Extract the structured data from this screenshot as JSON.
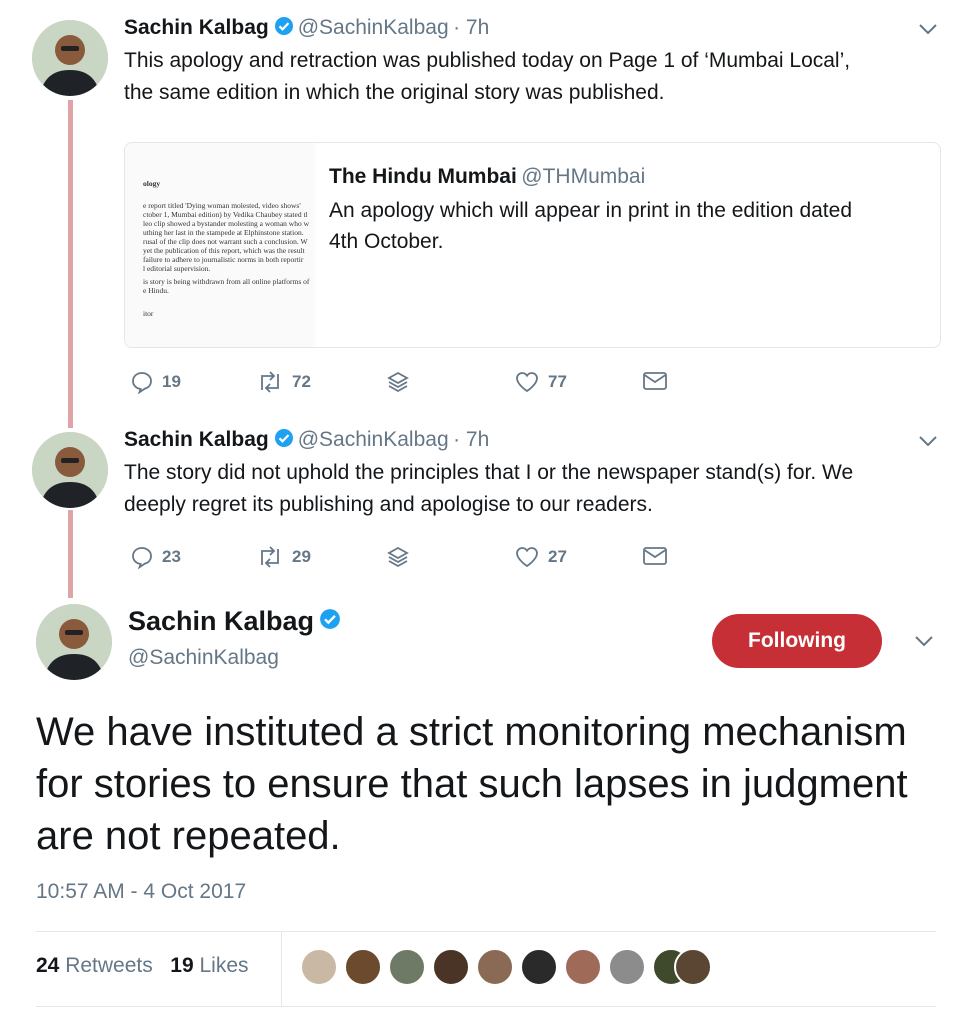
{
  "accent": "#c62f35",
  "verified_color": "#1da1f2",
  "tweets": [
    {
      "name": "Sachin Kalbag",
      "handle": "@SachinKalbag",
      "time": "· 7h",
      "text_line1": "This apology and retraction was published today on Page 1 of ‘Mumbai Local’,",
      "text_line2": "the same edition in which the original story was published.",
      "quote": {
        "name": "The Hindu Mumbai",
        "handle": "@THMumbai",
        "text_line1": "An apology which will appear in print in the edition dated",
        "text_line2": "4th October.",
        "doc_lines": [
          "ology",
          "e report titled 'Dying woman molested, video shows'",
          "ctober 1, Mumbai edition) by Vedika Chaubey stated tl",
          "leo clip showed a bystander molesting a woman who w",
          "uthing her last in the stampede at Elphinstone station.",
          "rusal of the clip does not warrant such a conclusion. W",
          "yet the publication of this report, which was the result",
          "failure to adhere to journalistic norms in both reportir",
          "l editorial supervision.",
          "is story is being withdrawn from all online platforms of",
          "e Hindu.",
          "itor"
        ]
      },
      "replies": "19",
      "retweets": "72",
      "likes": "77"
    },
    {
      "name": "Sachin Kalbag",
      "handle": "@SachinKalbag",
      "time": "· 7h",
      "text_line1": "The story did not uphold the principles that I or the newspaper stand(s) for. We",
      "text_line2": "deeply regret its publishing and apologise to our readers.",
      "replies": "23",
      "retweets": "29",
      "likes": "27"
    }
  ],
  "main": {
    "name": "Sachin Kalbag",
    "handle": "@SachinKalbag",
    "follow_label": "Following",
    "text": "We have instituted a strict monitoring mechanism for stories to ensure that such lapses in judgment are not repeated.",
    "timestamp": "10:57 AM - 4 Oct 2017",
    "retweet_count": "24",
    "retweet_label": "Retweets",
    "like_count": "19",
    "like_label": "Likes"
  }
}
